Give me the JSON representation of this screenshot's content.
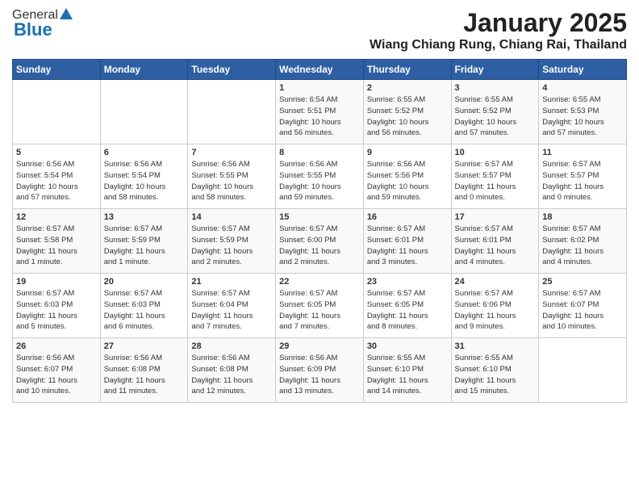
{
  "header": {
    "logo_general": "General",
    "logo_blue": "Blue",
    "title": "January 2025",
    "location": "Wiang Chiang Rung, Chiang Rai, Thailand"
  },
  "days_of_week": [
    "Sunday",
    "Monday",
    "Tuesday",
    "Wednesday",
    "Thursday",
    "Friday",
    "Saturday"
  ],
  "weeks": [
    [
      {
        "day": "",
        "info": ""
      },
      {
        "day": "",
        "info": ""
      },
      {
        "day": "",
        "info": ""
      },
      {
        "day": "1",
        "info": "Sunrise: 6:54 AM\nSunset: 5:51 PM\nDaylight: 10 hours\nand 56 minutes."
      },
      {
        "day": "2",
        "info": "Sunrise: 6:55 AM\nSunset: 5:52 PM\nDaylight: 10 hours\nand 56 minutes."
      },
      {
        "day": "3",
        "info": "Sunrise: 6:55 AM\nSunset: 5:52 PM\nDaylight: 10 hours\nand 57 minutes."
      },
      {
        "day": "4",
        "info": "Sunrise: 6:55 AM\nSunset: 5:53 PM\nDaylight: 10 hours\nand 57 minutes."
      }
    ],
    [
      {
        "day": "5",
        "info": "Sunrise: 6:56 AM\nSunset: 5:54 PM\nDaylight: 10 hours\nand 57 minutes."
      },
      {
        "day": "6",
        "info": "Sunrise: 6:56 AM\nSunset: 5:54 PM\nDaylight: 10 hours\nand 58 minutes."
      },
      {
        "day": "7",
        "info": "Sunrise: 6:56 AM\nSunset: 5:55 PM\nDaylight: 10 hours\nand 58 minutes."
      },
      {
        "day": "8",
        "info": "Sunrise: 6:56 AM\nSunset: 5:55 PM\nDaylight: 10 hours\nand 59 minutes."
      },
      {
        "day": "9",
        "info": "Sunrise: 6:56 AM\nSunset: 5:56 PM\nDaylight: 10 hours\nand 59 minutes."
      },
      {
        "day": "10",
        "info": "Sunrise: 6:57 AM\nSunset: 5:57 PM\nDaylight: 11 hours\nand 0 minutes."
      },
      {
        "day": "11",
        "info": "Sunrise: 6:57 AM\nSunset: 5:57 PM\nDaylight: 11 hours\nand 0 minutes."
      }
    ],
    [
      {
        "day": "12",
        "info": "Sunrise: 6:57 AM\nSunset: 5:58 PM\nDaylight: 11 hours\nand 1 minute."
      },
      {
        "day": "13",
        "info": "Sunrise: 6:57 AM\nSunset: 5:59 PM\nDaylight: 11 hours\nand 1 minute."
      },
      {
        "day": "14",
        "info": "Sunrise: 6:57 AM\nSunset: 5:59 PM\nDaylight: 11 hours\nand 2 minutes."
      },
      {
        "day": "15",
        "info": "Sunrise: 6:57 AM\nSunset: 6:00 PM\nDaylight: 11 hours\nand 2 minutes."
      },
      {
        "day": "16",
        "info": "Sunrise: 6:57 AM\nSunset: 6:01 PM\nDaylight: 11 hours\nand 3 minutes."
      },
      {
        "day": "17",
        "info": "Sunrise: 6:57 AM\nSunset: 6:01 PM\nDaylight: 11 hours\nand 4 minutes."
      },
      {
        "day": "18",
        "info": "Sunrise: 6:57 AM\nSunset: 6:02 PM\nDaylight: 11 hours\nand 4 minutes."
      }
    ],
    [
      {
        "day": "19",
        "info": "Sunrise: 6:57 AM\nSunset: 6:03 PM\nDaylight: 11 hours\nand 5 minutes."
      },
      {
        "day": "20",
        "info": "Sunrise: 6:57 AM\nSunset: 6:03 PM\nDaylight: 11 hours\nand 6 minutes."
      },
      {
        "day": "21",
        "info": "Sunrise: 6:57 AM\nSunset: 6:04 PM\nDaylight: 11 hours\nand 7 minutes."
      },
      {
        "day": "22",
        "info": "Sunrise: 6:57 AM\nSunset: 6:05 PM\nDaylight: 11 hours\nand 7 minutes."
      },
      {
        "day": "23",
        "info": "Sunrise: 6:57 AM\nSunset: 6:05 PM\nDaylight: 11 hours\nand 8 minutes."
      },
      {
        "day": "24",
        "info": "Sunrise: 6:57 AM\nSunset: 6:06 PM\nDaylight: 11 hours\nand 9 minutes."
      },
      {
        "day": "25",
        "info": "Sunrise: 6:57 AM\nSunset: 6:07 PM\nDaylight: 11 hours\nand 10 minutes."
      }
    ],
    [
      {
        "day": "26",
        "info": "Sunrise: 6:56 AM\nSunset: 6:07 PM\nDaylight: 11 hours\nand 10 minutes."
      },
      {
        "day": "27",
        "info": "Sunrise: 6:56 AM\nSunset: 6:08 PM\nDaylight: 11 hours\nand 11 minutes."
      },
      {
        "day": "28",
        "info": "Sunrise: 6:56 AM\nSunset: 6:08 PM\nDaylight: 11 hours\nand 12 minutes."
      },
      {
        "day": "29",
        "info": "Sunrise: 6:56 AM\nSunset: 6:09 PM\nDaylight: 11 hours\nand 13 minutes."
      },
      {
        "day": "30",
        "info": "Sunrise: 6:55 AM\nSunset: 6:10 PM\nDaylight: 11 hours\nand 14 minutes."
      },
      {
        "day": "31",
        "info": "Sunrise: 6:55 AM\nSunset: 6:10 PM\nDaylight: 11 hours\nand 15 minutes."
      },
      {
        "day": "",
        "info": ""
      }
    ]
  ]
}
